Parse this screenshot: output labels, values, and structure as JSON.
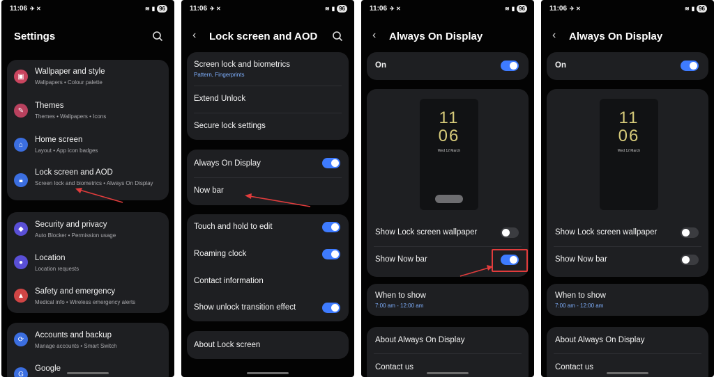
{
  "status_bar": {
    "time": "11:06",
    "battery": "96"
  },
  "screen1": {
    "title": "Settings",
    "groups": [
      {
        "items": [
          {
            "label": "Wallpaper and style",
            "sub": "Wallpapers  •  Colour palette",
            "icon": "palette-icon",
            "color": "#c9455f"
          },
          {
            "label": "Themes",
            "sub": "Themes  •  Wallpapers  •  Icons",
            "icon": "themes-icon",
            "color": "#b8415e"
          },
          {
            "label": "Home screen",
            "sub": "Layout  •  App icon badges",
            "icon": "home-icon",
            "color": "#3b6ee0"
          },
          {
            "label": "Lock screen and AOD",
            "sub": "Screen lock and biometrics  •  Always On Display",
            "icon": "lock-icon",
            "color": "#3b6ee0"
          }
        ]
      },
      {
        "items": [
          {
            "label": "Security and privacy",
            "sub": "Auto Blocker  •  Permission usage",
            "icon": "shield-icon",
            "color": "#5a4fd6"
          },
          {
            "label": "Location",
            "sub": "Location requests",
            "icon": "location-pin-icon",
            "color": "#5a4fd6"
          },
          {
            "label": "Safety and emergency",
            "sub": "Medical info  •  Wireless emergency alerts",
            "icon": "emergency-bell-icon",
            "color": "#d04545"
          }
        ]
      },
      {
        "items": [
          {
            "label": "Accounts and backup",
            "sub": "Manage accounts  •  Smart Switch",
            "icon": "sync-icon",
            "color": "#3b6ee0"
          },
          {
            "label": "Google",
            "sub": "",
            "icon": "google-icon",
            "color": "#3b6ee0"
          }
        ]
      }
    ]
  },
  "screen2": {
    "title": "Lock screen and AOD",
    "group1": [
      {
        "label": "Screen lock and biometrics",
        "sub": "Pattern, Fingerprints"
      },
      {
        "label": "Extend Unlock"
      },
      {
        "label": "Secure lock settings"
      }
    ],
    "group2": [
      {
        "label": "Always On Display",
        "toggle": "on"
      },
      {
        "label": "Now bar"
      }
    ],
    "group3": [
      {
        "label": "Touch and hold to edit",
        "toggle": "on"
      },
      {
        "label": "Roaming clock",
        "toggle": "on"
      },
      {
        "label": "Contact information"
      },
      {
        "label": "Show unlock transition effect",
        "toggle": "on"
      }
    ],
    "group4": [
      {
        "label": "About Lock screen"
      }
    ]
  },
  "aod_screen": {
    "title": "Always On Display",
    "master_label": "On",
    "clock_hour": "11",
    "clock_minute": "06",
    "clock_date": "Wed 12 March",
    "show_wallpaper_label": "Show Lock screen wallpaper",
    "show_nowbar_label": "Show Now bar",
    "when_label": "When to show",
    "when_value": "7:00 am - 12:00 am",
    "about_label": "About Always On Display",
    "contact_label": "Contact us"
  },
  "screen3_states": {
    "master": "on",
    "show_wallpaper": "off",
    "show_nowbar": "on"
  },
  "screen4_states": {
    "master": "on",
    "show_wallpaper": "off",
    "show_nowbar": "off"
  },
  "colors": {
    "accent": "#3e7bff",
    "annotation": "#e23c3c",
    "clock": "#d6ca7a"
  }
}
